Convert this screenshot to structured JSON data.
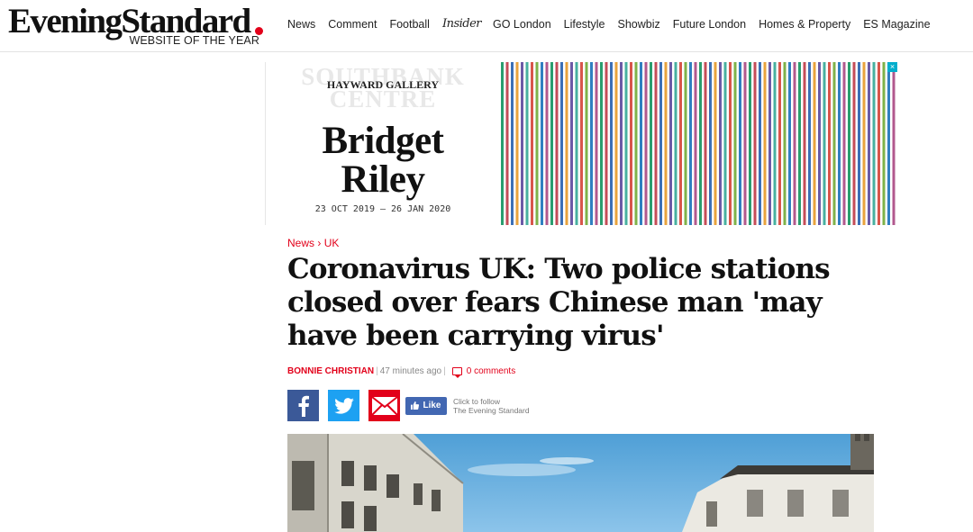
{
  "header": {
    "logo_text": "EveningStandard",
    "logo_tagline": "WEBSITE OF THE YEAR",
    "nav": [
      "News",
      "Comment",
      "Football",
      "Insider",
      "GO London",
      "Lifestyle",
      "Showbiz",
      "Future London",
      "Homes & Property",
      "ES Magazine"
    ]
  },
  "ad": {
    "southbank": "SOUTHBANK CENTRE",
    "gallery": "HAYWARD GALLERY",
    "title_line1": "Bridget",
    "title_line2": "Riley",
    "dates": "23 OCT 2019 – 26 JAN 2020",
    "close_label": "×",
    "stripe_colors": [
      "#2a9d6e",
      "#c44d58",
      "#3b6fb6",
      "#e8a33d",
      "#6b5aa6",
      "#48b0a0",
      "#d8554a",
      "#7fb24a",
      "#2f7fc1",
      "#b2598e"
    ]
  },
  "article": {
    "breadcrumb_section": "News",
    "breadcrumb_sep": "›",
    "breadcrumb_sub": "UK",
    "headline": "Coronavirus UK: Two police stations closed over fears Chinese man 'may have been carrying virus'",
    "author": "BONNIE CHRISTIAN",
    "timestamp": "47 minutes ago",
    "comments": "0 comments"
  },
  "share": {
    "like_label": "Like",
    "follow_line1": "Click to follow",
    "follow_line2": "The Evening Standard"
  },
  "colors": {
    "brand_red": "#e2001a",
    "facebook": "#3b5998",
    "twitter": "#1da1f2"
  }
}
